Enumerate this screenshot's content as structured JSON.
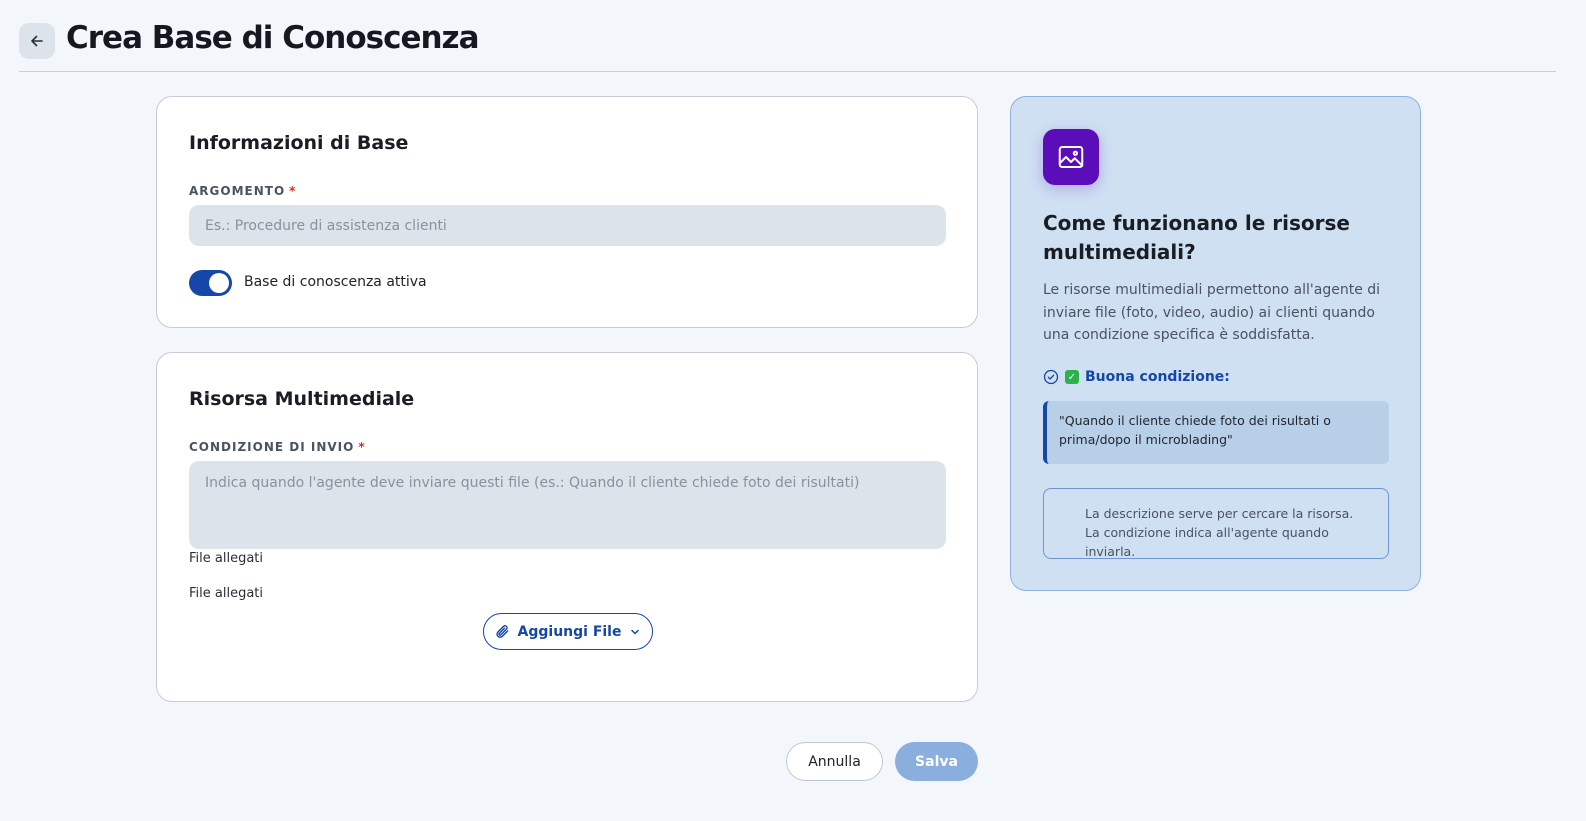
{
  "header": {
    "title": "Crea Base di Conoscenza"
  },
  "basic_info": {
    "title": "Informazioni di Base",
    "topic_label": "ARGOMENTO",
    "required_mark": "*",
    "topic_value": "",
    "topic_placeholder": "Es.: Procedure di assistenza clienti",
    "active_toggle_on": true,
    "active_toggle_label": "Base di conoscenza attiva"
  },
  "media": {
    "title": "Risorsa Multimediale",
    "condition_label": "CONDIZIONE DI INVIO",
    "required_mark": "*",
    "condition_value": "",
    "condition_placeholder": "Indica quando l'agente deve inviare questi file (es.: Quando il cliente chiede foto dei risultati)",
    "files_label_1": "File allegati",
    "files_label_2": "File allegati",
    "add_file_label": "Aggiungi File"
  },
  "info_panel": {
    "title": "Come funzionano le risorse multimediali?",
    "description": "Le risorse multimediali permettono all'agente di inviare file (foto, video, audio) ai clienti quando una condizione specifica è soddisfatta.",
    "good_condition_label": "Buona condizione:",
    "example_quote": "\"Quando il cliente chiede foto dei risultati o prima/dopo il microblading\"",
    "note": "La descrizione serve per cercare la risorsa. La condizione indica all'agente quando inviarla."
  },
  "footer": {
    "cancel_label": "Annulla",
    "save_label": "Salva"
  },
  "colors": {
    "accent": "#1547a8",
    "icon_bg": "#5a0db8",
    "panel_bg": "#cfe0f3",
    "save_disabled": "#8aaede"
  }
}
